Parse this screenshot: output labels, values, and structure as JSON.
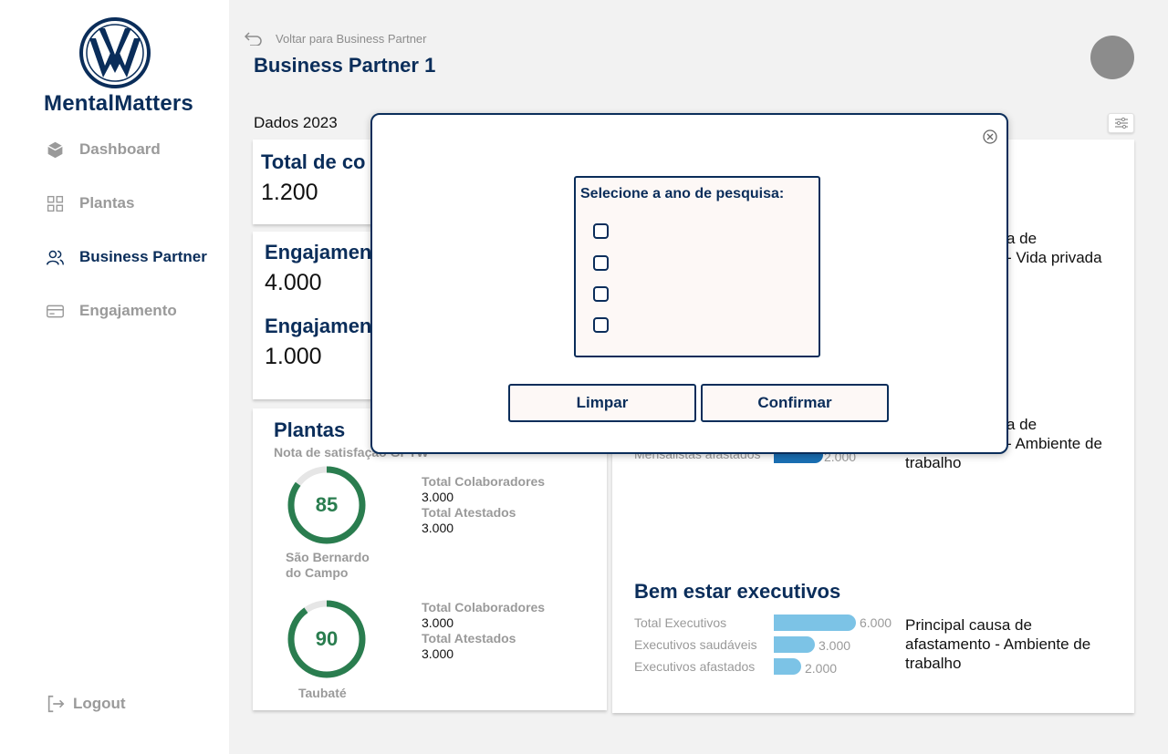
{
  "sidebar": {
    "brand": "MentalMatters",
    "items": [
      {
        "label": "Dashboard",
        "icon": "layers-icon"
      },
      {
        "label": "Plantas",
        "icon": "grid-icon"
      },
      {
        "label": "Business Partner",
        "icon": "users-icon"
      },
      {
        "label": "Engajamento",
        "icon": "card-icon"
      }
    ],
    "active": "Business Partner",
    "logout": "Logout"
  },
  "header": {
    "back": "Voltar para Business Partner",
    "title": "Business Partner 1",
    "year_label": "Dados 2023"
  },
  "cards": {
    "total": {
      "title": "Total de co",
      "value": "1.200"
    },
    "engagement_1": {
      "title": "Engajamen",
      "value": "4.000"
    },
    "engagement_2": {
      "title": "Engajamen",
      "value": "1.000"
    },
    "plantas": {
      "title": "Plantas",
      "subtitle": "Nota de satisfação GPTW",
      "plants": [
        {
          "name_line1": "São Bernardo",
          "name_line2": "do Campo",
          "score": "85",
          "score_fraction": 0.85,
          "colab_label": "Total Colaboradores",
          "colab_value": "3.000",
          "atest_label": "Total Atestados",
          "atest_value": "3.000"
        },
        {
          "name_line1": "Taubaté",
          "name_line2": "",
          "score": "90",
          "score_fraction": 0.9,
          "colab_label": "Total Colaboradores",
          "colab_value": "3.000",
          "atest_label": "Total Atestados",
          "atest_value": "3.000"
        }
      ]
    },
    "right": {
      "cause_top_l1": "a de",
      "cause_top_l2": "- Vida privada",
      "cause_mid_l1": "a de",
      "cause_mid_l2": "- Ambiente de",
      "cause_mid_l3": "trabalho",
      "mensalistas_label": "Mensalistas afastados",
      "mensalistas_value": "2.000",
      "executivos": {
        "title": "Bem estar executivos",
        "bars": [
          {
            "label": "Total Executivos",
            "value": "6.000",
            "num": 6000
          },
          {
            "label": "Executivos saudáveis",
            "value": "3.000",
            "num": 3000
          },
          {
            "label": "Executivos afastados",
            "value": "2.000",
            "num": 2000
          }
        ],
        "cause_l1": "Principal causa de",
        "cause_l2": "afastamento  - Ambiente de",
        "cause_l3": "trabalho"
      }
    }
  },
  "modal": {
    "title": "Selecione a ano de pesquisa:",
    "clear": "Limpar",
    "confirm": "Confirmar"
  },
  "colors": {
    "primary": "#0a2d5a",
    "gauge": "#2a7d4f",
    "bar": "#7cc3e6"
  }
}
